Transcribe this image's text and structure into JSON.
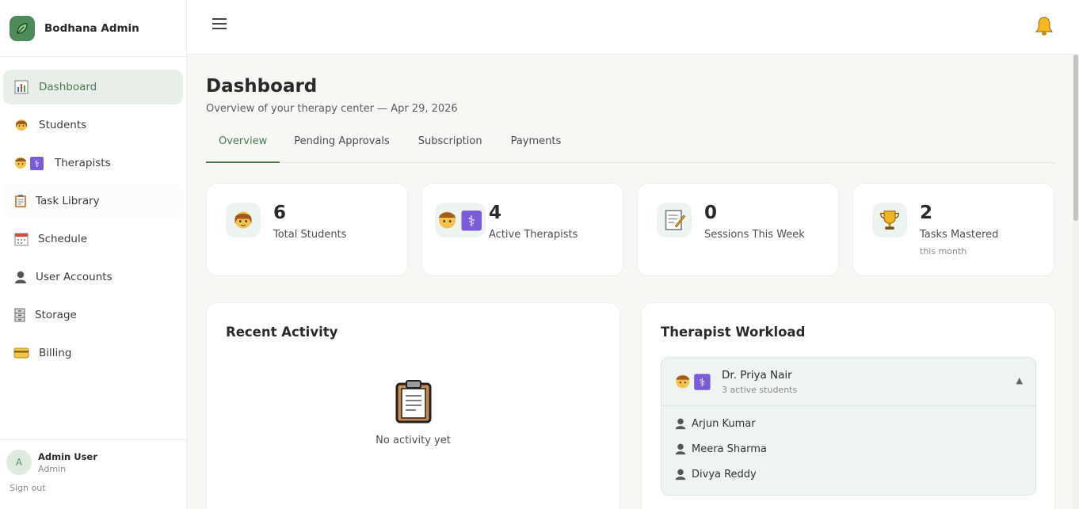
{
  "brand": {
    "name": "Bodhana Admin",
    "logo_icon": "leaf-icon",
    "accent": "#4f8a5b"
  },
  "sidebar": {
    "items": [
      {
        "label": "Dashboard",
        "icon": "bar-chart-icon",
        "active": true
      },
      {
        "label": "Students",
        "icon": "student-icon"
      },
      {
        "label": "Therapists",
        "icon": "therapist-icon"
      },
      {
        "label": "Task Library",
        "icon": "clipboard-icon"
      },
      {
        "label": "Schedule",
        "icon": "calendar-icon"
      },
      {
        "label": "User Accounts",
        "icon": "user-silhouette-icon"
      },
      {
        "label": "Storage",
        "icon": "cabinet-icon"
      },
      {
        "label": "Billing",
        "icon": "credit-card-icon"
      }
    ]
  },
  "user": {
    "initial": "A",
    "name": "Admin User",
    "role": "Admin",
    "signout_label": "Sign out"
  },
  "header": {
    "menu_icon": "hamburger-icon",
    "notification_icon": "bell-icon"
  },
  "page": {
    "title": "Dashboard",
    "subtitle": "Overview of your therapy center — Apr 29, 2026",
    "tabs": [
      {
        "label": "Overview",
        "active": true
      },
      {
        "label": "Pending Approvals"
      },
      {
        "label": "Subscription"
      },
      {
        "label": "Payments"
      }
    ]
  },
  "stats": [
    {
      "value": "6",
      "label": "Total Students",
      "icon": "student-icon"
    },
    {
      "value": "4",
      "label": "Active Therapists",
      "icon": "therapist-icon"
    },
    {
      "value": "0",
      "label": "Sessions This Week",
      "icon": "memo-icon"
    },
    {
      "value": "2",
      "label": "Tasks Mastered",
      "note": "this month",
      "icon": "trophy-icon"
    }
  ],
  "recent_activity": {
    "title": "Recent Activity",
    "empty_text": "No activity yet",
    "empty_icon": "clipboard-icon"
  },
  "workload": {
    "title": "Therapist Workload",
    "therapist": {
      "name": "Dr. Priya Nair",
      "sub": "3 active students",
      "caret": "▲"
    },
    "students": [
      "Arjun Kumar",
      "Meera Sharma",
      "Divya Reddy"
    ]
  }
}
